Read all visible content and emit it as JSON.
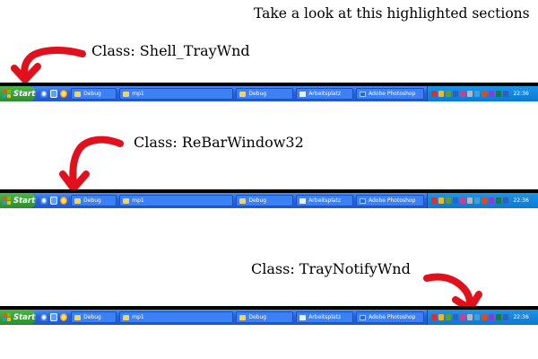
{
  "headline": "Take a look at this highlighted sections",
  "sections": [
    {
      "caption": "Class: Shell_TrayWnd"
    },
    {
      "caption": "Class: ReBarWindow32"
    },
    {
      "caption": "Class: TrayNotifyWnd"
    }
  ],
  "taskbar": {
    "start_label": "Start",
    "tasks": [
      "Debug",
      "mp1",
      "Debug",
      "Arbeitsplatz",
      "Adobe Photoshop"
    ],
    "clock": "22:36",
    "quicklaunch_icons": [
      "internet-explorer-icon",
      "show-desktop-icon",
      "media-player-icon"
    ],
    "tray_icon_colors": [
      "#d93030",
      "#f2b81e",
      "#5c9e2f",
      "#2b63c8",
      "#d23b90",
      "#b7b7b7",
      "#3aa0e0",
      "#e04a1a",
      "#8a3bd8",
      "#1e7a3b",
      "#2f5fbf"
    ]
  },
  "colors": {
    "arrow": "#e0101c",
    "taskbar_blue": "#2a62d8",
    "start_green": "#3a9e3a",
    "tray_blue": "#0d79d2"
  }
}
